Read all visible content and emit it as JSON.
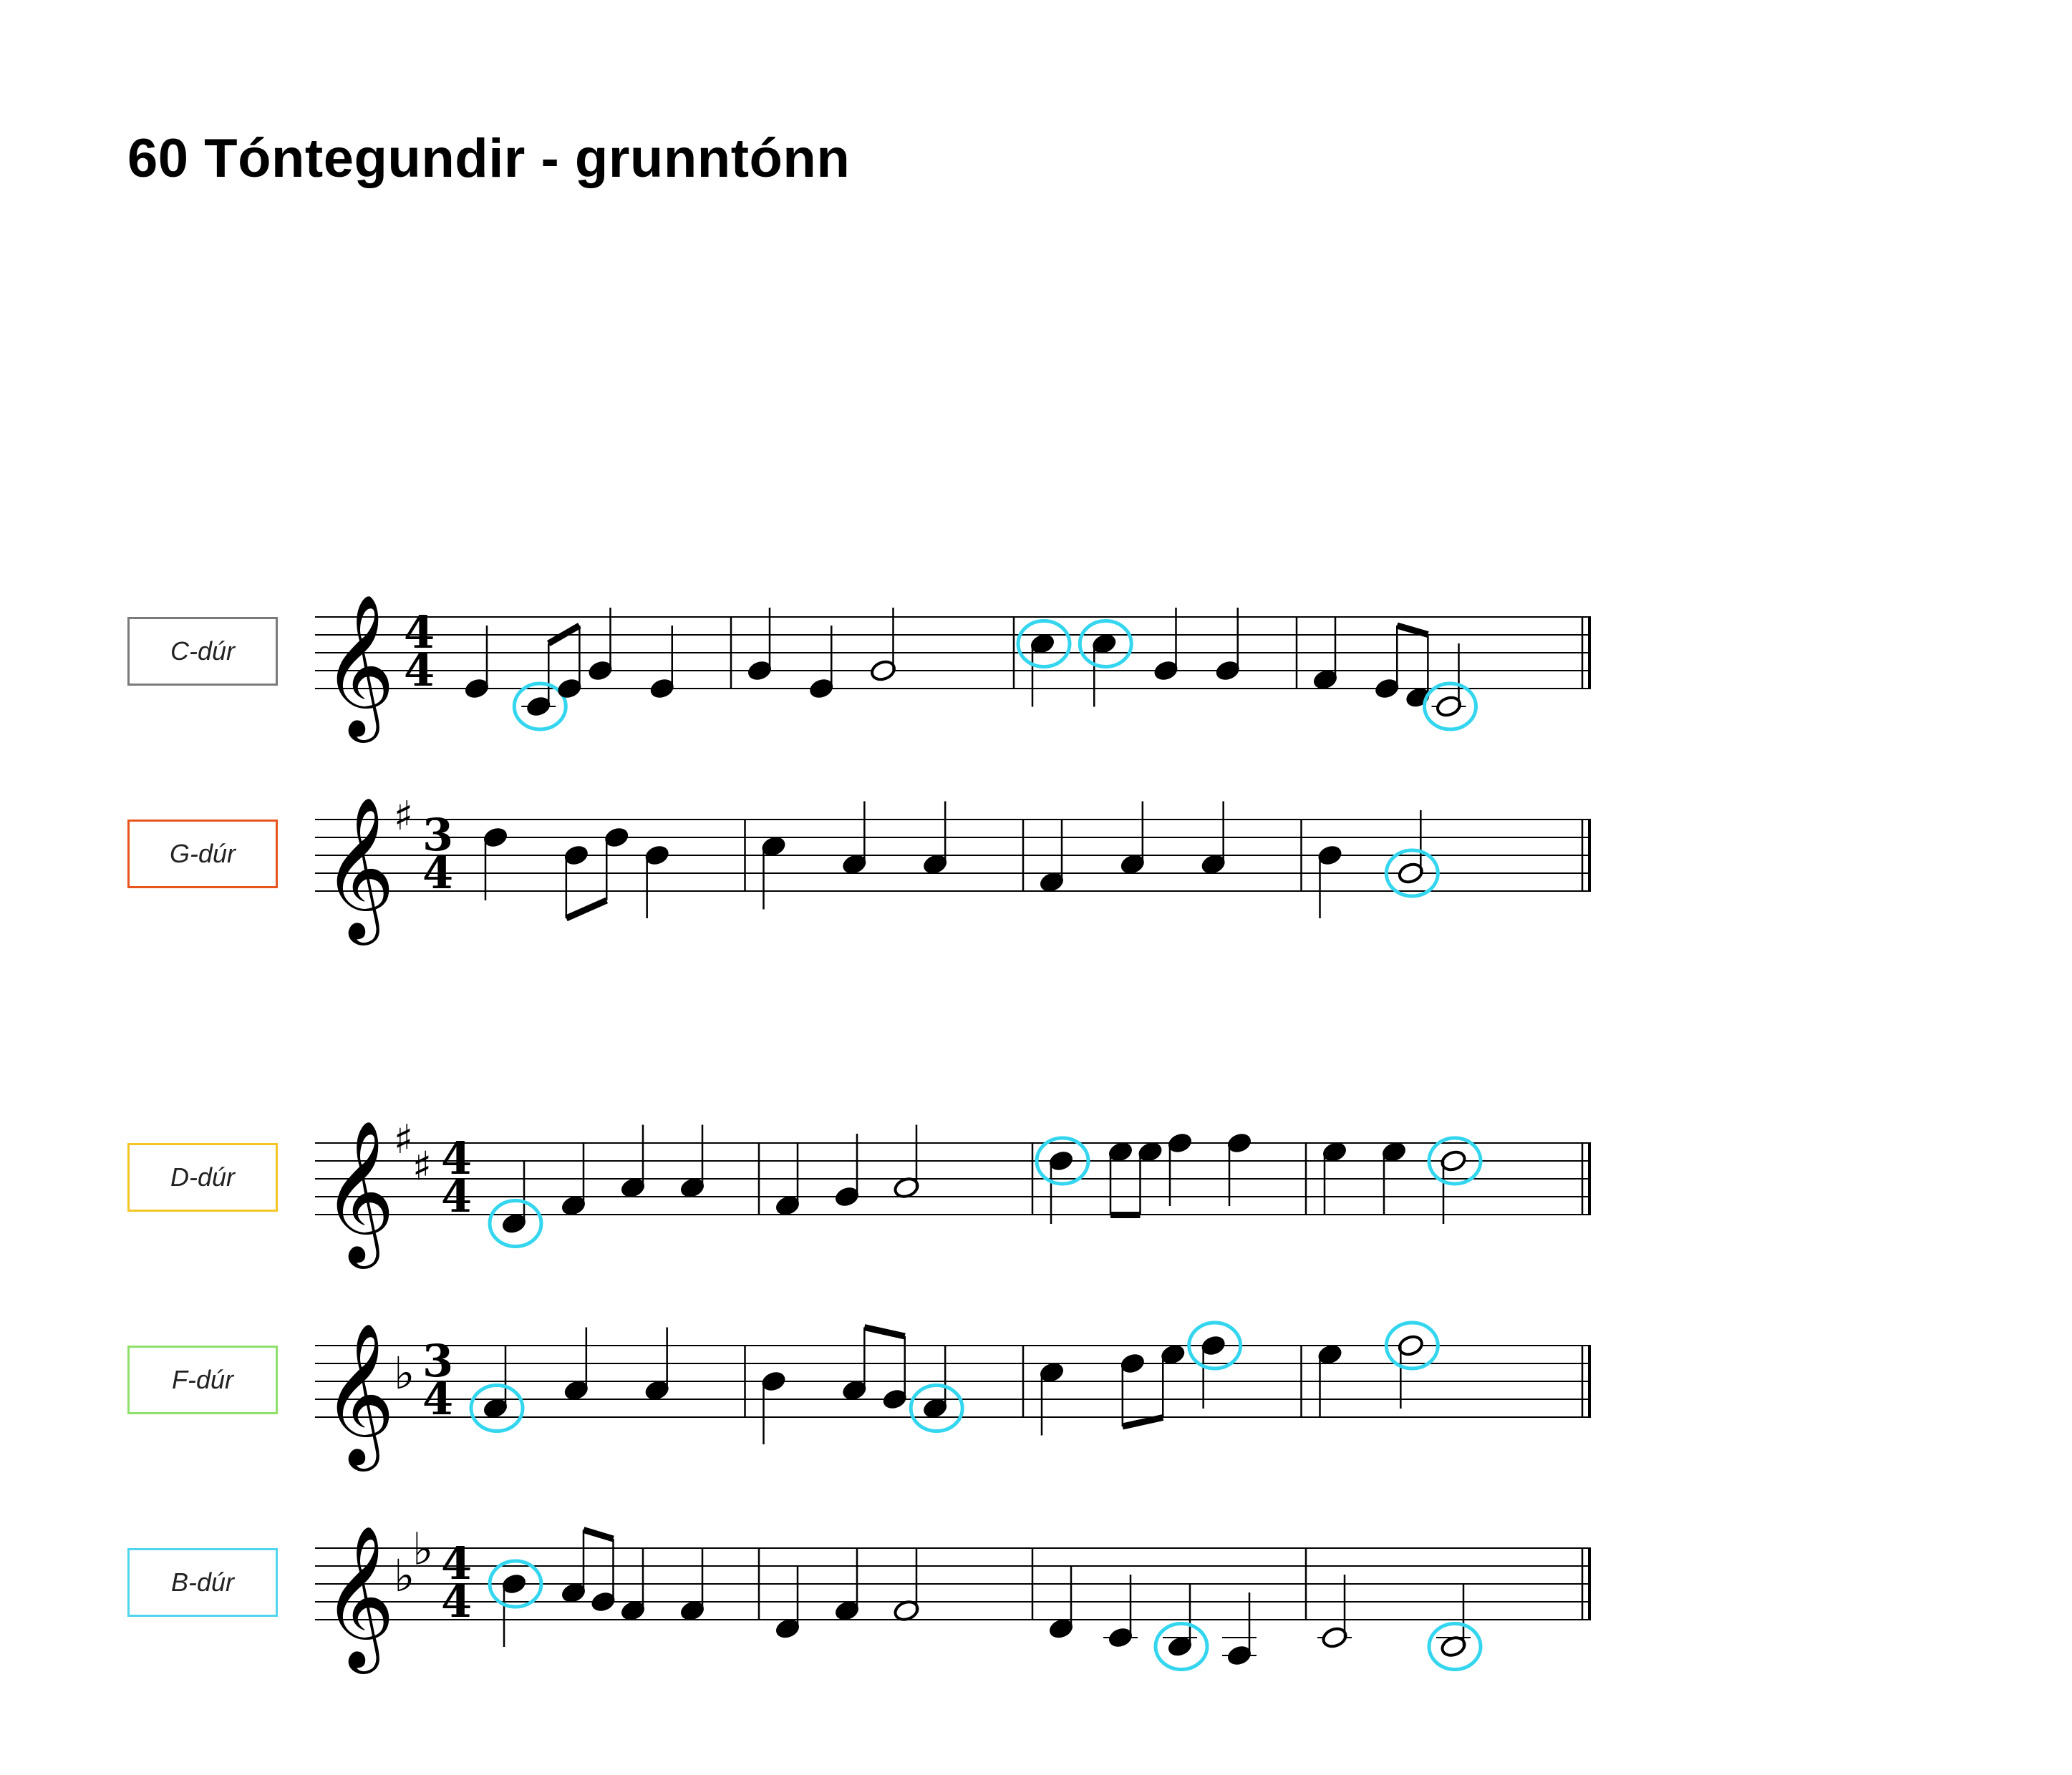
{
  "title": "60  Tóntegundir - grunntónn",
  "highlight_color": "#33d6ee",
  "rows": [
    {
      "key_label": "C-dúr",
      "key_color": "#7a7a7a",
      "clef": "treble",
      "key_signature": [],
      "time_signature": [
        "4",
        "4"
      ],
      "measures": [
        [
          {
            "pitch": "E4",
            "duration": "quarter"
          },
          {
            "pitch": "C4",
            "duration": "eighth",
            "highlight": true
          },
          {
            "pitch": "E4",
            "duration": "eighth"
          },
          {
            "pitch": "G4",
            "duration": "quarter"
          },
          {
            "pitch": "E4",
            "duration": "quarter"
          }
        ],
        [
          {
            "pitch": "G4",
            "duration": "quarter"
          },
          {
            "pitch": "E4",
            "duration": "quarter"
          },
          {
            "pitch": "G4",
            "duration": "half"
          }
        ],
        [
          {
            "pitch": "C5",
            "duration": "quarter",
            "highlight": true
          },
          {
            "pitch": "C5",
            "duration": "quarter",
            "highlight": true
          },
          {
            "pitch": "G4",
            "duration": "quarter"
          },
          {
            "pitch": "G4",
            "duration": "quarter"
          }
        ],
        [
          {
            "pitch": "F4",
            "duration": "quarter"
          },
          {
            "pitch": "E4",
            "duration": "eighth"
          },
          {
            "pitch": "D4",
            "duration": "eighth"
          },
          {
            "pitch": "C4",
            "duration": "half",
            "highlight": true
          }
        ]
      ]
    },
    {
      "key_label": "G-dúr",
      "key_color": "#e8541e",
      "clef": "treble",
      "key_signature": [
        "sharp"
      ],
      "time_signature": [
        "3",
        "4"
      ],
      "measures": [
        [
          {
            "pitch": "D5",
            "duration": "quarter"
          },
          {
            "pitch": "B4",
            "duration": "eighth"
          },
          {
            "pitch": "D5",
            "duration": "eighth"
          },
          {
            "pitch": "B4",
            "duration": "quarter"
          }
        ],
        [
          {
            "pitch": "C5",
            "duration": "quarter"
          },
          {
            "pitch": "A4",
            "duration": "quarter"
          },
          {
            "pitch": "A4",
            "duration": "quarter"
          }
        ],
        [
          {
            "pitch": "F4",
            "duration": "quarter"
          },
          {
            "pitch": "A4",
            "duration": "quarter"
          },
          {
            "pitch": "A4",
            "duration": "quarter"
          }
        ],
        [
          {
            "pitch": "B4",
            "duration": "quarter"
          },
          {
            "pitch": "G4",
            "duration": "half",
            "highlight": true
          }
        ]
      ]
    },
    {
      "key_label": "D-dúr",
      "key_color": "#f3c623",
      "clef": "treble",
      "key_signature": [
        "sharp",
        "sharp"
      ],
      "time_signature": [
        "4",
        "4"
      ],
      "measures": [
        [
          {
            "pitch": "D4",
            "duration": "quarter",
            "highlight": true
          },
          {
            "pitch": "F4",
            "duration": "quarter"
          },
          {
            "pitch": "A4",
            "duration": "quarter"
          },
          {
            "pitch": "A4",
            "duration": "quarter"
          }
        ],
        [
          {
            "pitch": "F4",
            "duration": "quarter"
          },
          {
            "pitch": "G4",
            "duration": "quarter"
          },
          {
            "pitch": "A4",
            "duration": "half"
          }
        ],
        [
          {
            "pitch": "D5",
            "duration": "quarter",
            "highlight": true
          },
          {
            "pitch": "E5",
            "duration": "eighth"
          },
          {
            "pitch": "E5",
            "duration": "eighth"
          },
          {
            "pitch": "F5",
            "duration": "quarter"
          },
          {
            "pitch": "F5",
            "duration": "quarter"
          }
        ],
        [
          {
            "pitch": "E5",
            "duration": "quarter"
          },
          {
            "pitch": "E5",
            "duration": "quarter"
          },
          {
            "pitch": "D5",
            "duration": "half",
            "highlight": true
          }
        ]
      ]
    },
    {
      "key_label": "F-dúr",
      "key_color": "#8ee06a",
      "clef": "treble",
      "key_signature": [
        "flat"
      ],
      "time_signature": [
        "3",
        "4"
      ],
      "measures": [
        [
          {
            "pitch": "F4",
            "duration": "quarter",
            "highlight": true
          },
          {
            "pitch": "A4",
            "duration": "quarter"
          },
          {
            "pitch": "A4",
            "duration": "quarter"
          }
        ],
        [
          {
            "pitch": "B4",
            "duration": "quarter"
          },
          {
            "pitch": "A4",
            "duration": "eighth"
          },
          {
            "pitch": "G4",
            "duration": "eighth"
          },
          {
            "pitch": "F4",
            "duration": "quarter",
            "highlight": true
          }
        ],
        [
          {
            "pitch": "C5",
            "duration": "quarter"
          },
          {
            "pitch": "D5",
            "duration": "eighth"
          },
          {
            "pitch": "E5",
            "duration": "eighth"
          },
          {
            "pitch": "F5",
            "duration": "quarter",
            "highlight": true
          }
        ],
        [
          {
            "pitch": "E5",
            "duration": "quarter"
          },
          {
            "pitch": "F5",
            "duration": "half",
            "highlight": true
          }
        ]
      ]
    },
    {
      "key_label": "B-dúr",
      "key_color": "#4fd6ee",
      "clef": "treble",
      "key_signature": [
        "flat",
        "flat"
      ],
      "time_signature": [
        "4",
        "4"
      ],
      "measures": [
        [
          {
            "pitch": "B4",
            "duration": "quarter",
            "highlight": true
          },
          {
            "pitch": "A4",
            "duration": "eighth"
          },
          {
            "pitch": "G4",
            "duration": "eighth"
          },
          {
            "pitch": "F4",
            "duration": "quarter"
          },
          {
            "pitch": "F4",
            "duration": "quarter"
          }
        ],
        [
          {
            "pitch": "D4",
            "duration": "quarter"
          },
          {
            "pitch": "F4",
            "duration": "quarter"
          },
          {
            "pitch": "F4",
            "duration": "half"
          }
        ],
        [
          {
            "pitch": "D4",
            "duration": "quarter"
          },
          {
            "pitch": "C4",
            "duration": "quarter"
          },
          {
            "pitch": "B3",
            "duration": "quarter",
            "highlight": true
          },
          {
            "pitch": "A3",
            "duration": "quarter"
          }
        ],
        [
          {
            "pitch": "C4",
            "duration": "half"
          },
          {
            "pitch": "B3",
            "duration": "half",
            "highlight": true
          }
        ]
      ]
    }
  ]
}
